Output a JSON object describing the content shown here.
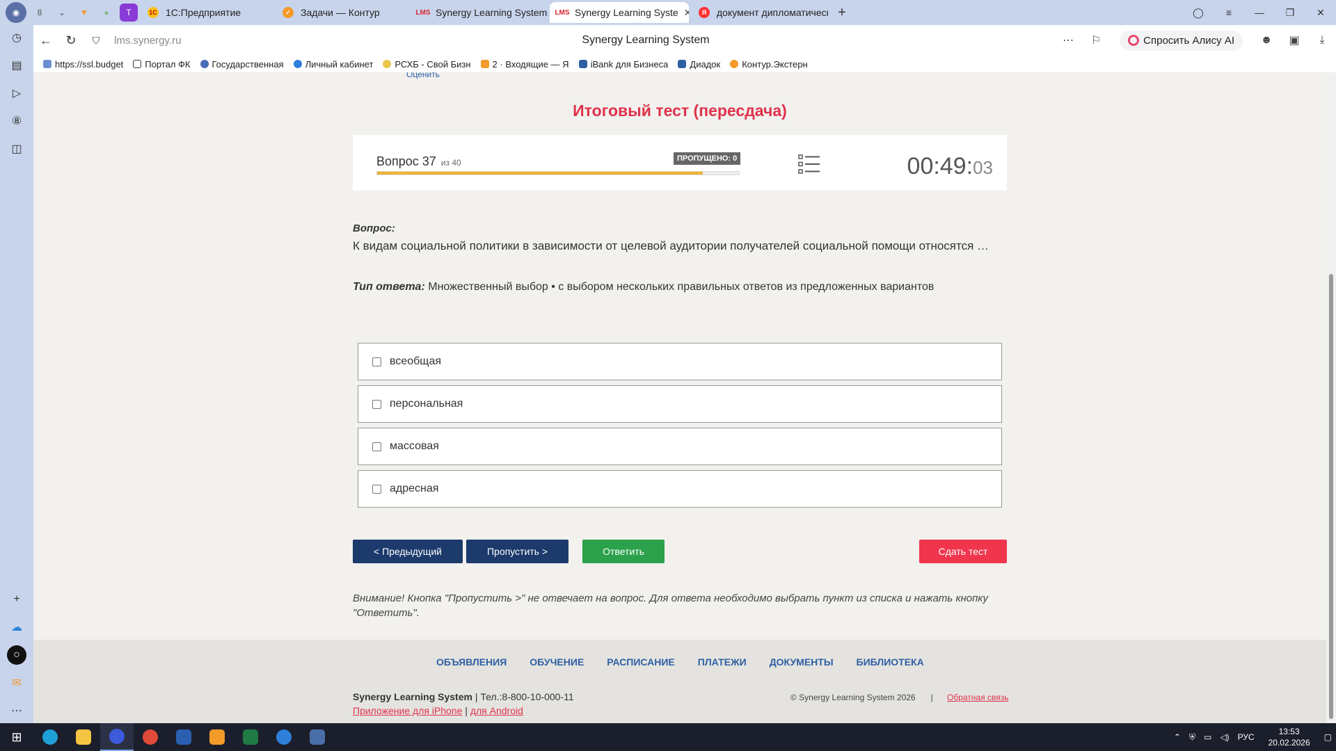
{
  "browser": {
    "tabs": [
      {
        "label": "1С:Предприятие",
        "color": "#f5c31a"
      },
      {
        "label": "Задачи — Контур",
        "color": "#f39a2a"
      },
      {
        "label": "Synergy Learning System",
        "color": "#d9232d"
      },
      {
        "label": "Synergy Learning Syste",
        "color": "#d9232d"
      },
      {
        "label": "документ дипломатическ",
        "color": "#f33"
      }
    ],
    "url": "lms.synergy.ru",
    "page_title": "Synergy Learning System",
    "alice_label": "Спросить Алису AI",
    "bookmarks": [
      "https://ssl.budget",
      "Портал ФК",
      "Государственная",
      "Личный кабинет",
      "РСХБ - Свой Бизн",
      "2 · Входящие — Я",
      "iBank для Бизнеса",
      "Диадок",
      "Контур.Экстерн"
    ]
  },
  "page": {
    "rate_link": "Оценить",
    "title": "Итоговый тест (пересдача)",
    "progress": {
      "question_label": "Вопрос 37",
      "of_label": "из 40",
      "skipped": "ПРОПУЩЕНО: 0",
      "fraction": 0.9
    },
    "timer": {
      "main": "00:49:",
      "seconds": "03"
    },
    "question": {
      "label": "Вопрос:",
      "text": "К видам социальной политики в зависимости от целевой аудитории получателей социальной помощи относятся …"
    },
    "answer_type": {
      "label": "Тип ответа:",
      "value": "Множественный выбор • с выбором нескольких правильных ответов из предложенных вариантов"
    },
    "options": [
      "всеобщая",
      "персональная",
      "массовая",
      "адресная"
    ],
    "buttons": {
      "prev": "< Предыдущий",
      "skip": "Пропустить >",
      "answer": "Ответить",
      "submit": "Сдать тест"
    },
    "warning": "Внимание! Кнопка \"Пропустить >\" не отвечает на вопрос. Для ответа необходимо выбрать пункт из списка и нажать кнопку \"Ответить\"."
  },
  "footer": {
    "nav": [
      "ОБЪЯВЛЕНИЯ",
      "ОБУЧЕНИЕ",
      "РАСПИСАНИЕ",
      "ПЛАТЕЖИ",
      "ДОКУМЕНТЫ",
      "БИБЛИОТЕКА"
    ],
    "brand": "Synergy Learning System",
    "phone": "Тел.:8-800-10-000-11",
    "iphone_link": "Приложение для iPhone",
    "android_link": "для Android",
    "copyright": "© Synergy Learning System 2026",
    "feedback": "Обратная связь"
  },
  "taskbar": {
    "lang": "РУС",
    "time": "13:53",
    "date": "20.02.2026"
  },
  "colors": {
    "accent_red": "#e0324b",
    "navy": "#1c3a6b",
    "green": "#2aa14a",
    "progress": "#f0b232"
  }
}
